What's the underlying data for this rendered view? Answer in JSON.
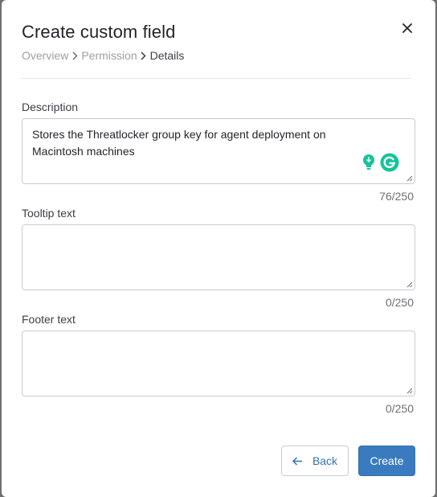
{
  "dialog": {
    "title": "Create custom field",
    "close_icon": "close-icon"
  },
  "breadcrumb": {
    "items": [
      "Overview",
      "Permission",
      "Details"
    ],
    "current_index": 2
  },
  "fields": {
    "description": {
      "label": "Description",
      "value": "Stores the Threatlocker group key for agent deployment on Macintosh machines",
      "counter": "76/250"
    },
    "tooltip": {
      "label": "Tooltip text",
      "value": "",
      "counter": "0/250"
    },
    "footer": {
      "label": "Footer text",
      "value": "",
      "counter": "0/250"
    }
  },
  "actions": {
    "back_label": "Back",
    "create_label": "Create"
  },
  "colors": {
    "primary": "#3a7bbf",
    "grammarly": "#15c39a"
  }
}
